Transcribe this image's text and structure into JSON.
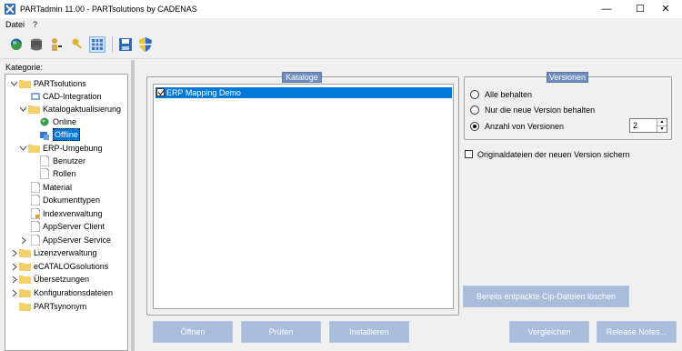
{
  "window": {
    "title": "PARTadmin 11.00 - PARTsolutions by CADENAS",
    "controls": {
      "minimize": "—",
      "maximize": "☐",
      "close": "✕"
    }
  },
  "menu": {
    "items": [
      "Datei",
      "?"
    ]
  },
  "toolbar": {
    "icons": [
      "refresh-globe-icon",
      "database-icon",
      "user-key-icon",
      "keys-icon",
      "settings-grid-icon",
      "save-icon",
      "shield-icon"
    ]
  },
  "sidebar": {
    "label": "Kategorie:",
    "tree": [
      {
        "label": "PARTsolutions"
      },
      {
        "label": "CAD-Integration"
      },
      {
        "label": "Katalogaktualisierung"
      },
      {
        "label": "Online"
      },
      {
        "label": "Offline",
        "selected": true
      },
      {
        "label": "ERP-Umgebung"
      },
      {
        "label": "Benutzer"
      },
      {
        "label": "Rollen"
      },
      {
        "label": "Material"
      },
      {
        "label": "Dokumenttypen"
      },
      {
        "label": "Indexverwaltung"
      },
      {
        "label": "AppServer Client"
      },
      {
        "label": "AppServer Service"
      },
      {
        "label": "Lizenzverwaltung"
      },
      {
        "label": "eCATALOGsolutions"
      },
      {
        "label": "Übersetzungen"
      },
      {
        "label": "Konfigurationsdateien"
      },
      {
        "label": "PARTsynonym"
      }
    ]
  },
  "kataloge": {
    "title": "Kataloge",
    "items": [
      {
        "label": "ERP Mapping Demo",
        "checked": true
      }
    ]
  },
  "versionen": {
    "title": "Versionen",
    "options": [
      {
        "label": "Alle behalten",
        "selected": false
      },
      {
        "label": "Nur die neue Version behalten",
        "selected": false
      },
      {
        "label": "Anzahl von Versionen",
        "selected": true
      }
    ],
    "count": "2",
    "spin_up": "▲",
    "spin_down": "▼"
  },
  "backup_checkbox": {
    "label": "Originaldateien der neuen Version sichern",
    "checked": false
  },
  "buttons": {
    "delete_cip": "Bereits entpackte Cip-Dateien löschen",
    "open": "Öffnen",
    "check": "Prüfen",
    "install": "Installieren",
    "compare": "Vergleichen",
    "release_notes": "Release Notes..."
  }
}
